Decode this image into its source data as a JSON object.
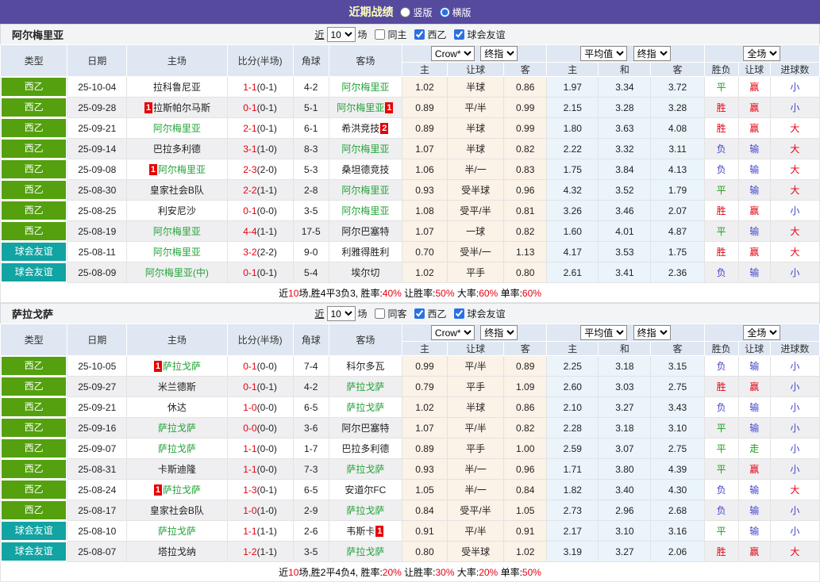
{
  "titlebar": {
    "title": "近期战绩",
    "radio_vertical": "竖版",
    "radio_horizontal": "横版",
    "vertical_checked": false,
    "horizontal_checked": true
  },
  "colors": {
    "purple": "#564a9e",
    "title_yellow": "#ffffbb",
    "league_green": "#54a00f",
    "friendly_teal": "#12a3a3",
    "team_green": "#23a338",
    "score_red": "#e60012",
    "win_red": "#e60012",
    "draw_green": "#18a018",
    "lose_blue": "#4343cc",
    "header_bg": "#dfe7f2",
    "odds_bg": "#fbf2e8",
    "avg_bg": "#eaf4fa",
    "stripe_gray": "#efeff1"
  },
  "columns": {
    "type": "类型",
    "date": "日期",
    "home": "主场",
    "score": "比分(半场)",
    "corner": "角球",
    "away": "客场",
    "odds_home": "主",
    "odds_handicap": "让球",
    "odds_away": "客",
    "avg_home": "主",
    "avg_draw": "和",
    "avg_away": "客",
    "result": "胜负",
    "handicap_result": "让球",
    "goals": "进球数"
  },
  "sections": [
    {
      "team": "阿尔梅里亚",
      "filter": {
        "recent_label": "近",
        "count": "10",
        "games_label": "场",
        "same_label": "同主",
        "league_label": "西乙",
        "friendly_label": "球会友谊",
        "same_checked": false,
        "league_checked": true,
        "friendly_checked": true
      },
      "selects": {
        "odds_source": "Crow*",
        "odds_final": "终指",
        "avg_source": "平均值",
        "avg_final": "终指",
        "scope": "全场"
      },
      "rows": [
        {
          "league": "西乙",
          "date": "25-10-04",
          "home": "拉科鲁尼亚",
          "home_focus": false,
          "home_card": 0,
          "score": "1-1",
          "half": "(0-1)",
          "corners": "4-2",
          "away": "阿尔梅里亚",
          "away_focus": true,
          "away_card": 0,
          "odds": [
            "1.02",
            "半球",
            "0.86"
          ],
          "avg": [
            "1.97",
            "3.34",
            "3.72"
          ],
          "result": "平",
          "handicap": "赢",
          "goals": "小"
        },
        {
          "league": "西乙",
          "date": "25-09-28",
          "home": "拉斯帕尔马斯",
          "home_focus": false,
          "home_card": 1,
          "score": "0-1",
          "half": "(0-1)",
          "corners": "5-1",
          "away": "阿尔梅里亚",
          "away_focus": true,
          "away_card": 1,
          "odds": [
            "0.89",
            "平/半",
            "0.99"
          ],
          "avg": [
            "2.15",
            "3.28",
            "3.28"
          ],
          "result": "胜",
          "handicap": "赢",
          "goals": "小"
        },
        {
          "league": "西乙",
          "date": "25-09-21",
          "home": "阿尔梅里亚",
          "home_focus": true,
          "home_card": 0,
          "score": "2-1",
          "half": "(0-1)",
          "corners": "6-1",
          "away": "希洪竞技",
          "away_focus": false,
          "away_card": 2,
          "odds": [
            "0.89",
            "半球",
            "0.99"
          ],
          "avg": [
            "1.80",
            "3.63",
            "4.08"
          ],
          "result": "胜",
          "handicap": "赢",
          "goals": "大"
        },
        {
          "league": "西乙",
          "date": "25-09-14",
          "home": "巴拉多利德",
          "home_focus": false,
          "home_card": 0,
          "score": "3-1",
          "half": "(1-0)",
          "corners": "8-3",
          "away": "阿尔梅里亚",
          "away_focus": true,
          "away_card": 0,
          "odds": [
            "1.07",
            "半球",
            "0.82"
          ],
          "avg": [
            "2.22",
            "3.32",
            "3.11"
          ],
          "result": "负",
          "handicap": "输",
          "goals": "大"
        },
        {
          "league": "西乙",
          "date": "25-09-08",
          "home": "阿尔梅里亚",
          "home_focus": true,
          "home_card": 1,
          "score": "2-3",
          "half": "(2-0)",
          "corners": "5-3",
          "away": "桑坦德竞技",
          "away_focus": false,
          "away_card": 0,
          "odds": [
            "1.06",
            "半/一",
            "0.83"
          ],
          "avg": [
            "1.75",
            "3.84",
            "4.13"
          ],
          "result": "负",
          "handicap": "输",
          "goals": "大"
        },
        {
          "league": "西乙",
          "date": "25-08-30",
          "home": "皇家社会B队",
          "home_focus": false,
          "home_card": 0,
          "score": "2-2",
          "half": "(1-1)",
          "corners": "2-8",
          "away": "阿尔梅里亚",
          "away_focus": true,
          "away_card": 0,
          "odds": [
            "0.93",
            "受半球",
            "0.96"
          ],
          "avg": [
            "4.32",
            "3.52",
            "1.79"
          ],
          "result": "平",
          "handicap": "输",
          "goals": "大"
        },
        {
          "league": "西乙",
          "date": "25-08-25",
          "home": "利安尼沙",
          "home_focus": false,
          "home_card": 0,
          "score": "0-1",
          "half": "(0-0)",
          "corners": "3-5",
          "away": "阿尔梅里亚",
          "away_focus": true,
          "away_card": 0,
          "odds": [
            "1.08",
            "受平/半",
            "0.81"
          ],
          "avg": [
            "3.26",
            "3.46",
            "2.07"
          ],
          "result": "胜",
          "handicap": "赢",
          "goals": "小"
        },
        {
          "league": "西乙",
          "date": "25-08-19",
          "home": "阿尔梅里亚",
          "home_focus": true,
          "home_card": 0,
          "score": "4-4",
          "half": "(1-1)",
          "corners": "17-5",
          "away": "阿尔巴塞特",
          "away_focus": false,
          "away_card": 0,
          "odds": [
            "1.07",
            "一球",
            "0.82"
          ],
          "avg": [
            "1.60",
            "4.01",
            "4.87"
          ],
          "result": "平",
          "handicap": "输",
          "goals": "大"
        },
        {
          "league": "球会友谊",
          "date": "25-08-11",
          "home": "阿尔梅里亚",
          "home_focus": true,
          "home_card": 0,
          "score": "3-2",
          "half": "(2-2)",
          "corners": "9-0",
          "away": "利雅得胜利",
          "away_focus": false,
          "away_card": 0,
          "odds": [
            "0.70",
            "受半/一",
            "1.13"
          ],
          "avg": [
            "4.17",
            "3.53",
            "1.75"
          ],
          "result": "胜",
          "handicap": "赢",
          "goals": "大"
        },
        {
          "league": "球会友谊",
          "date": "25-08-09",
          "home": "阿尔梅里亚(中)",
          "home_focus": true,
          "home_card": 0,
          "score": "0-1",
          "half": "(0-1)",
          "corners": "5-4",
          "away": "埃尔切",
          "away_focus": false,
          "away_card": 0,
          "odds": [
            "1.02",
            "平手",
            "0.80"
          ],
          "avg": [
            "2.61",
            "3.41",
            "2.36"
          ],
          "result": "负",
          "handicap": "输",
          "goals": "小"
        }
      ],
      "summary_parts": [
        {
          "t": "近"
        },
        {
          "t": "10",
          "red": true
        },
        {
          "t": "场,胜4平3负3, 胜率:"
        },
        {
          "t": "40%",
          "red": true
        },
        {
          "t": " 让胜率:"
        },
        {
          "t": "50%",
          "red": true
        },
        {
          "t": " 大率:"
        },
        {
          "t": "60%",
          "red": true
        },
        {
          "t": " 单率:"
        },
        {
          "t": "60%",
          "red": true
        }
      ]
    },
    {
      "team": "萨拉戈萨",
      "filter": {
        "recent_label": "近",
        "count": "10",
        "games_label": "场",
        "same_label": "同客",
        "league_label": "西乙",
        "friendly_label": "球会友谊",
        "same_checked": false,
        "league_checked": true,
        "friendly_checked": true
      },
      "selects": {
        "odds_source": "Crow*",
        "odds_final": "终指",
        "avg_source": "平均值",
        "avg_final": "终指",
        "scope": "全场"
      },
      "rows": [
        {
          "league": "西乙",
          "date": "25-10-05",
          "home": "萨拉戈萨",
          "home_focus": true,
          "home_card": 1,
          "score": "0-1",
          "half": "(0-0)",
          "corners": "7-4",
          "away": "科尔多瓦",
          "away_focus": false,
          "away_card": 0,
          "odds": [
            "0.99",
            "平/半",
            "0.89"
          ],
          "avg": [
            "2.25",
            "3.18",
            "3.15"
          ],
          "result": "负",
          "handicap": "输",
          "goals": "小"
        },
        {
          "league": "西乙",
          "date": "25-09-27",
          "home": "米兰德斯",
          "home_focus": false,
          "home_card": 0,
          "score": "0-1",
          "half": "(0-1)",
          "corners": "4-2",
          "away": "萨拉戈萨",
          "away_focus": true,
          "away_card": 0,
          "odds": [
            "0.79",
            "平手",
            "1.09"
          ],
          "avg": [
            "2.60",
            "3.03",
            "2.75"
          ],
          "result": "胜",
          "handicap": "赢",
          "goals": "小"
        },
        {
          "league": "西乙",
          "date": "25-09-21",
          "home": "休达",
          "home_focus": false,
          "home_card": 0,
          "score": "1-0",
          "half": "(0-0)",
          "corners": "6-5",
          "away": "萨拉戈萨",
          "away_focus": true,
          "away_card": 0,
          "odds": [
            "1.02",
            "半球",
            "0.86"
          ],
          "avg": [
            "2.10",
            "3.27",
            "3.43"
          ],
          "result": "负",
          "handicap": "输",
          "goals": "小"
        },
        {
          "league": "西乙",
          "date": "25-09-16",
          "home": "萨拉戈萨",
          "home_focus": true,
          "home_card": 0,
          "score": "0-0",
          "half": "(0-0)",
          "corners": "3-6",
          "away": "阿尔巴塞特",
          "away_focus": false,
          "away_card": 0,
          "odds": [
            "1.07",
            "平/半",
            "0.82"
          ],
          "avg": [
            "2.28",
            "3.18",
            "3.10"
          ],
          "result": "平",
          "handicap": "输",
          "goals": "小"
        },
        {
          "league": "西乙",
          "date": "25-09-07",
          "home": "萨拉戈萨",
          "home_focus": true,
          "home_card": 0,
          "score": "1-1",
          "half": "(0-0)",
          "corners": "1-7",
          "away": "巴拉多利德",
          "away_focus": false,
          "away_card": 0,
          "odds": [
            "0.89",
            "平手",
            "1.00"
          ],
          "avg": [
            "2.59",
            "3.07",
            "2.75"
          ],
          "result": "平",
          "handicap": "走",
          "goals": "小"
        },
        {
          "league": "西乙",
          "date": "25-08-31",
          "home": "卡斯迪隆",
          "home_focus": false,
          "home_card": 0,
          "score": "1-1",
          "half": "(0-0)",
          "corners": "7-3",
          "away": "萨拉戈萨",
          "away_focus": true,
          "away_card": 0,
          "odds": [
            "0.93",
            "半/一",
            "0.96"
          ],
          "avg": [
            "1.71",
            "3.80",
            "4.39"
          ],
          "result": "平",
          "handicap": "赢",
          "goals": "小"
        },
        {
          "league": "西乙",
          "date": "25-08-24",
          "home": "萨拉戈萨",
          "home_focus": true,
          "home_card": 1,
          "score": "1-3",
          "half": "(0-1)",
          "corners": "6-5",
          "away": "安道尔FC",
          "away_focus": false,
          "away_card": 0,
          "odds": [
            "1.05",
            "半/一",
            "0.84"
          ],
          "avg": [
            "1.82",
            "3.40",
            "4.30"
          ],
          "result": "负",
          "handicap": "输",
          "goals": "大"
        },
        {
          "league": "西乙",
          "date": "25-08-17",
          "home": "皇家社会B队",
          "home_focus": false,
          "home_card": 0,
          "score": "1-0",
          "half": "(1-0)",
          "corners": "2-9",
          "away": "萨拉戈萨",
          "away_focus": true,
          "away_card": 0,
          "odds": [
            "0.84",
            "受平/半",
            "1.05"
          ],
          "avg": [
            "2.73",
            "2.96",
            "2.68"
          ],
          "result": "负",
          "handicap": "输",
          "goals": "小"
        },
        {
          "league": "球会友谊",
          "date": "25-08-10",
          "home": "萨拉戈萨",
          "home_focus": true,
          "home_card": 0,
          "score": "1-1",
          "half": "(1-1)",
          "corners": "2-6",
          "away": "韦斯卡",
          "away_focus": false,
          "away_card": 1,
          "odds": [
            "0.91",
            "平/半",
            "0.91"
          ],
          "avg": [
            "2.17",
            "3.10",
            "3.16"
          ],
          "result": "平",
          "handicap": "输",
          "goals": "小"
        },
        {
          "league": "球会友谊",
          "date": "25-08-07",
          "home": "塔拉戈纳",
          "home_focus": false,
          "home_card": 0,
          "score": "1-2",
          "half": "(1-1)",
          "corners": "3-5",
          "away": "萨拉戈萨",
          "away_focus": true,
          "away_card": 0,
          "odds": [
            "0.80",
            "受半球",
            "1.02"
          ],
          "avg": [
            "3.19",
            "3.27",
            "2.06"
          ],
          "result": "胜",
          "handicap": "赢",
          "goals": "大"
        }
      ],
      "summary_parts": [
        {
          "t": "近"
        },
        {
          "t": "10",
          "red": true
        },
        {
          "t": "场,胜2平4负4, 胜率:"
        },
        {
          "t": "20%",
          "red": true
        },
        {
          "t": " 让胜率:"
        },
        {
          "t": "30%",
          "red": true
        },
        {
          "t": " 大率:"
        },
        {
          "t": "20%",
          "red": true
        },
        {
          "t": " 单率:"
        },
        {
          "t": "50%",
          "red": true
        }
      ]
    }
  ]
}
